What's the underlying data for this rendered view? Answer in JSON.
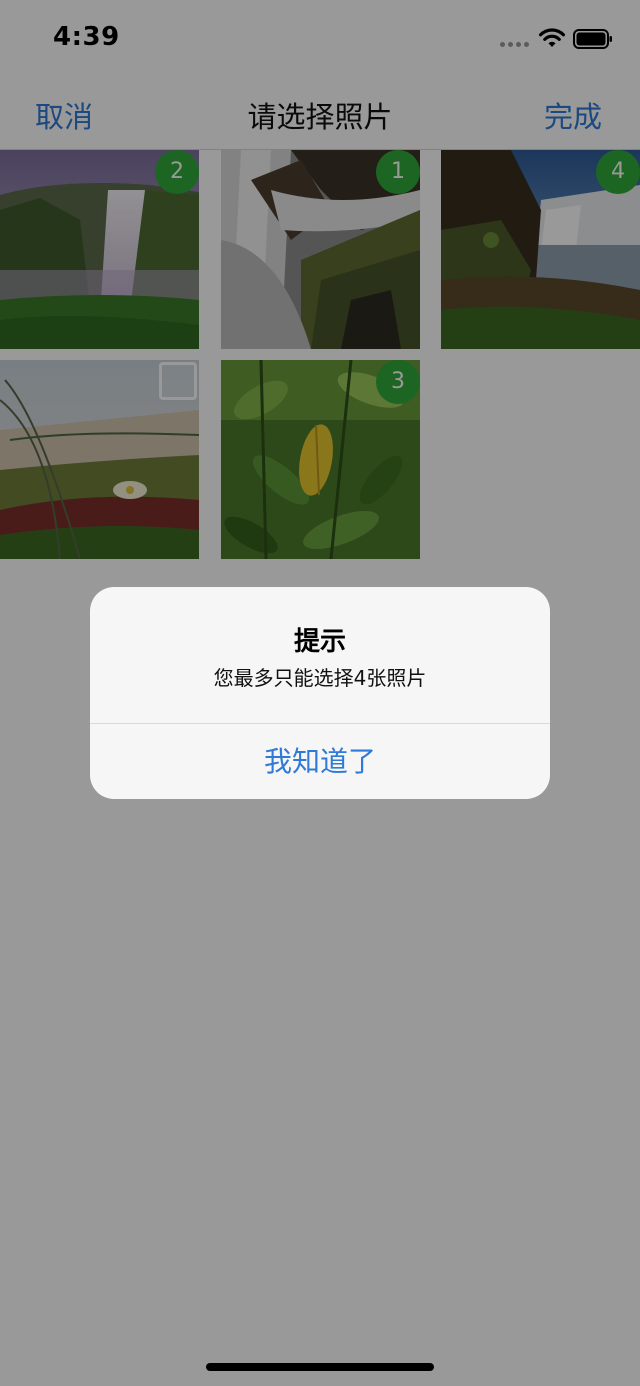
{
  "status_bar": {
    "time": "4:39",
    "icons": [
      "signal-dots-icon",
      "wifi-icon",
      "battery-icon"
    ]
  },
  "nav_bar": {
    "cancel_label": "取消",
    "title": "请选择照片",
    "done_label": "完成"
  },
  "photos": [
    {
      "subject": "waterfall-cliff",
      "selected": true,
      "selection_number": "2"
    },
    {
      "subject": "waterfall-rocks-closeup",
      "selected": true,
      "selection_number": "1"
    },
    {
      "subject": "waterfall-river-bank",
      "selected": true,
      "selection_number": "4"
    },
    {
      "subject": "grass-flowers",
      "selected": false,
      "selection_number": ""
    },
    {
      "subject": "green-leaves",
      "selected": true,
      "selection_number": "3"
    }
  ],
  "alert": {
    "title": "提示",
    "message": "您最多只能选择4张照片",
    "button_label": "我知道了"
  },
  "colors": {
    "accent": "#2f7ad6",
    "badge": "#31a93a",
    "overlay": "rgba(0,0,0,0.40)"
  }
}
